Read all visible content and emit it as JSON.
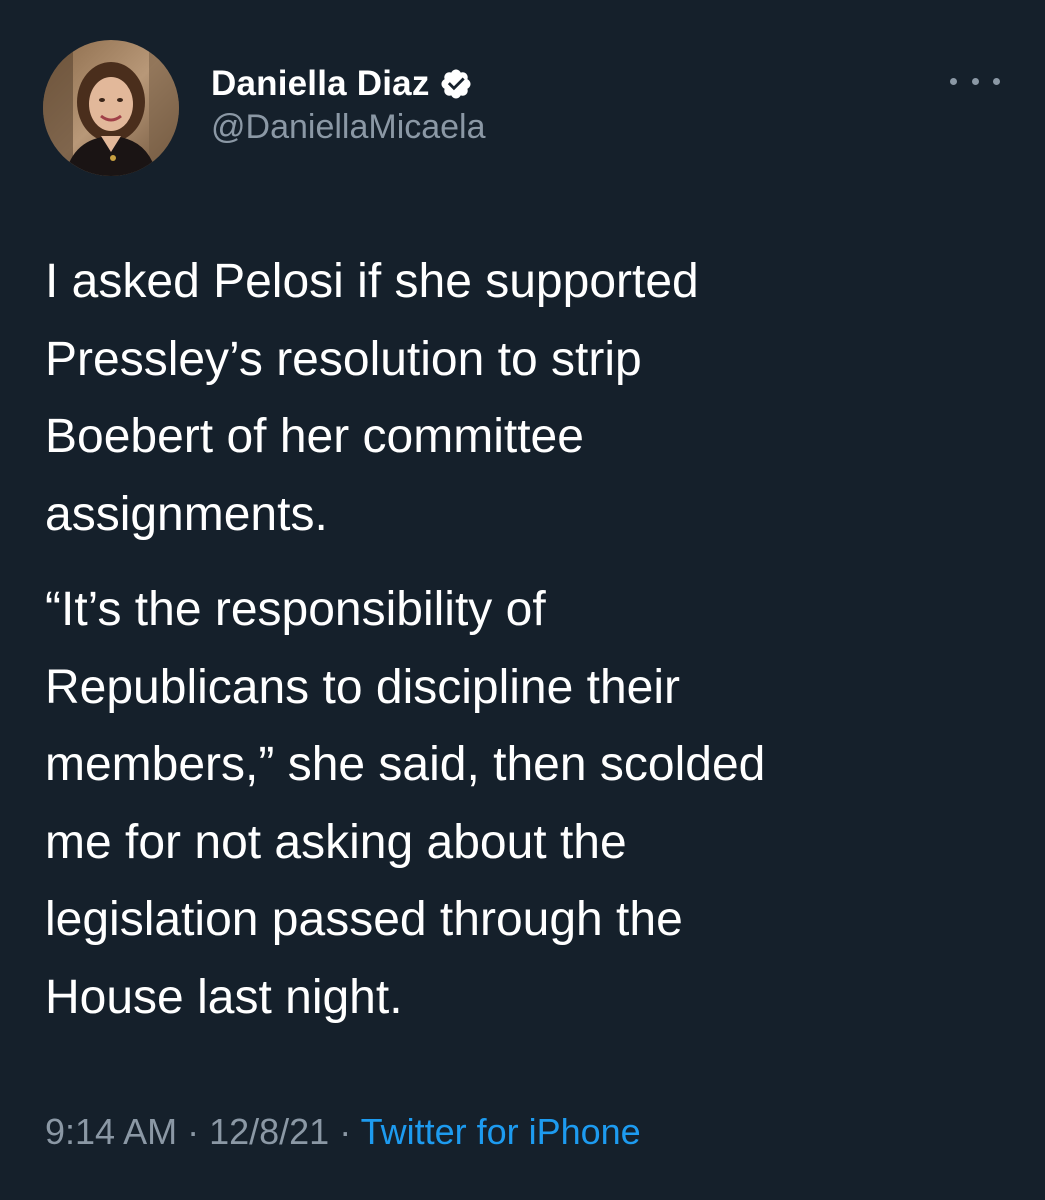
{
  "author": {
    "display_name": "Daniella Diaz",
    "handle": "@DaniellaMicaela",
    "verified": true,
    "avatar_icon": "profile-photo"
  },
  "menu": {
    "icon": "more-options-icon"
  },
  "tweet": {
    "paragraph_1": "I asked Pelosi if she supported\nPressley’s resolution to strip\nBoebert of her committee\nassignments.",
    "paragraph_2": "“It’s the responsibility of\nRepublicans to discipline their\nmembers,” she said, then scolded\nme for not asking about the\nlegislation passed through the\nHouse last night."
  },
  "meta": {
    "time": "9:14 AM",
    "separator": " · ",
    "date": "12/8/21",
    "source": "Twitter for iPhone"
  },
  "colors": {
    "background": "#15202b",
    "text": "#ffffff",
    "secondary": "#8b98a5",
    "accent": "#1d9bf0"
  }
}
